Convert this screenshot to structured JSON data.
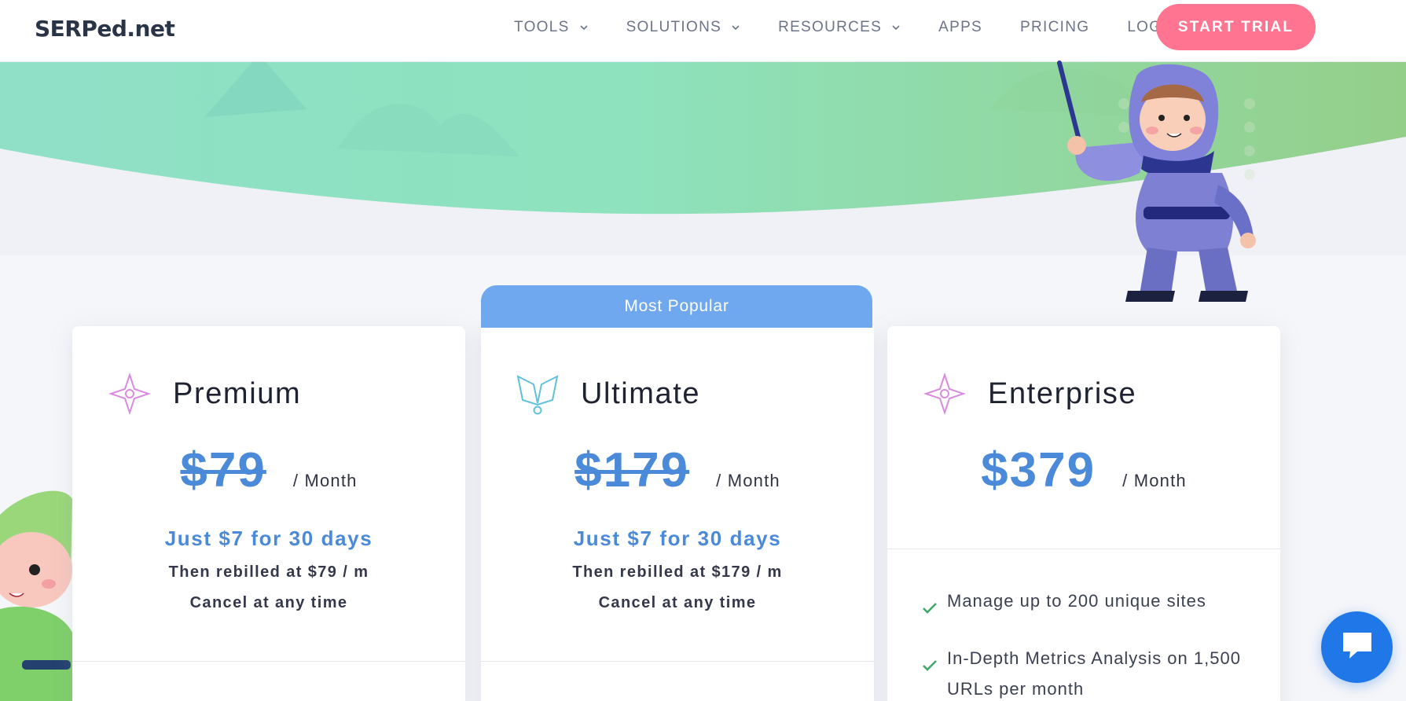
{
  "header": {
    "logo_text": "SERPed.net",
    "nav": [
      {
        "label": "TOOLS",
        "has_dropdown": true
      },
      {
        "label": "SOLUTIONS",
        "has_dropdown": true
      },
      {
        "label": "RESOURCES",
        "has_dropdown": true
      },
      {
        "label": "APPS",
        "has_dropdown": false
      },
      {
        "label": "PRICING",
        "has_dropdown": false
      },
      {
        "label": "LOGIN",
        "has_dropdown": false
      }
    ],
    "cta_label": "START TRIAL"
  },
  "badge": {
    "label": "Most Popular"
  },
  "plans": [
    {
      "name": "Premium",
      "icon": "shuriken-icon",
      "price": "$79",
      "price_struck": true,
      "per": "/ Month",
      "trial": "Just $7 for 30 days",
      "rebill": "Then rebilled at $79 / m",
      "cancel": "Cancel at any time"
    },
    {
      "name": "Ultimate",
      "icon": "mask-icon",
      "price": "$179",
      "price_struck": true,
      "per": "/ Month",
      "trial": "Just $7 for 30 days",
      "rebill": "Then rebilled at $179 / m",
      "cancel": "Cancel at any time"
    },
    {
      "name": "Enterprise",
      "icon": "shuriken-icon",
      "price": "$379",
      "price_struck": false,
      "per": "/ Month",
      "features": [
        "Manage up to 200 unique sites",
        "In-Depth Metrics Analysis on 1,500 URLs per month"
      ]
    }
  ],
  "colors": {
    "accent_blue": "#4a8ad8",
    "cta_pink": "#ff7491",
    "badge_blue": "#6fa8ee",
    "check_green": "#3fa96a",
    "chat_blue": "#1f77e8"
  },
  "chat": {
    "icon": "chat-icon"
  }
}
